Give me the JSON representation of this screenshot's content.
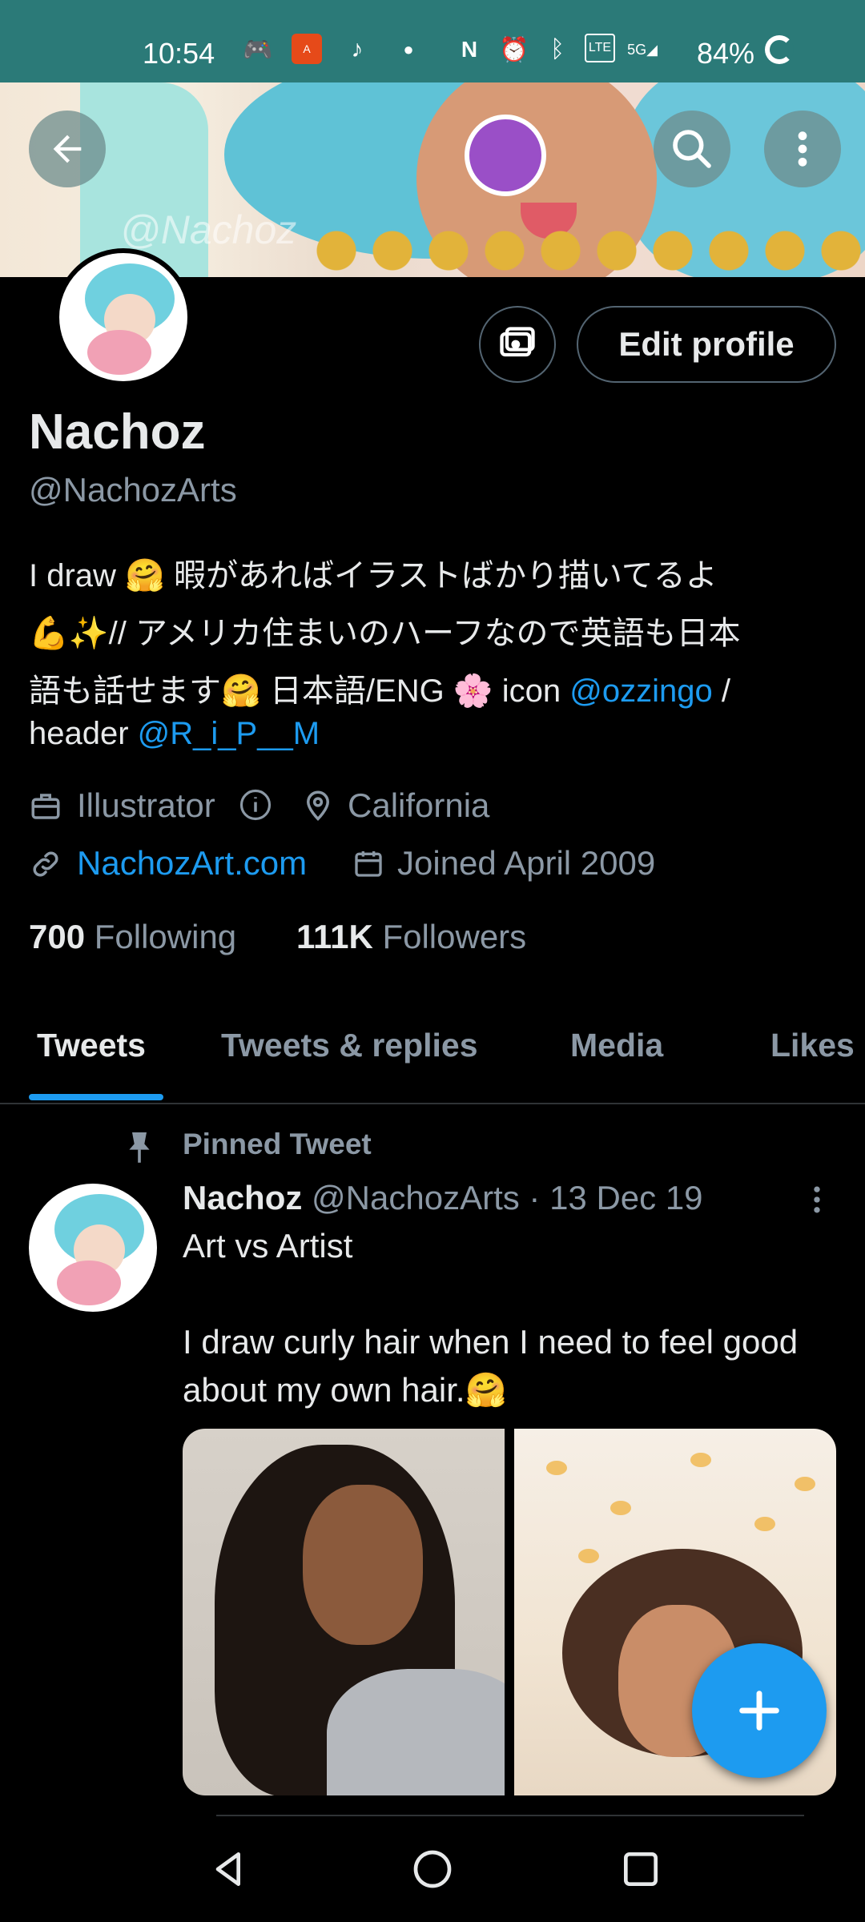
{
  "status_bar": {
    "time": "10:54",
    "battery": "84%",
    "network": "5G"
  },
  "header": {
    "banner_watermark": "@Nachoz"
  },
  "profile": {
    "name": "Nachoz",
    "handle": "@NachozArts",
    "edit_profile_label": "Edit profile",
    "bio": {
      "line1": "I draw 🤗 暇があればイラストばかり描いてるよ",
      "line2": "💪✨// アメリカ住まいのハーフなので英語も日本",
      "line3a": "語も話せます🤗 日本語/ENG 🌸 icon ",
      "line3_link": "@ozzingo",
      "line3b": " /",
      "line4a": "header ",
      "line4_link": "@R_i_P__M"
    },
    "profession": "Illustrator",
    "location": "California",
    "website": "NachozArt.com",
    "joined": "Joined April 2009",
    "following_count": "700",
    "following_label": "Following",
    "followers_count": "111K",
    "followers_label": "Followers"
  },
  "tabs": [
    {
      "label": "Tweets",
      "active": true
    },
    {
      "label": "Tweets & replies",
      "active": false
    },
    {
      "label": "Media",
      "active": false
    },
    {
      "label": "Likes",
      "active": false
    }
  ],
  "pinned_tweet": {
    "label": "Pinned Tweet",
    "author_name": "Nachoz",
    "author_handle": "@NachozArts",
    "date": "· 13 Dec 19",
    "text_line1": "Art vs Artist",
    "text_line2": "I draw curly hair when I need to feel good",
    "text_line3": "about my own hair.🤗"
  },
  "colors": {
    "accent": "#1d9bf0",
    "status_bar": "#2b7a78",
    "background": "#000000",
    "muted": "#8b98a5"
  },
  "icons": [
    "back-arrow-icon",
    "search-icon",
    "more-vertical-icon",
    "camera-sync-icon",
    "briefcase-icon",
    "info-icon",
    "location-pin-icon",
    "link-icon",
    "calendar-icon",
    "pin-icon",
    "compose-plus-icon",
    "nav-back-icon",
    "nav-home-icon",
    "nav-recents-icon"
  ]
}
